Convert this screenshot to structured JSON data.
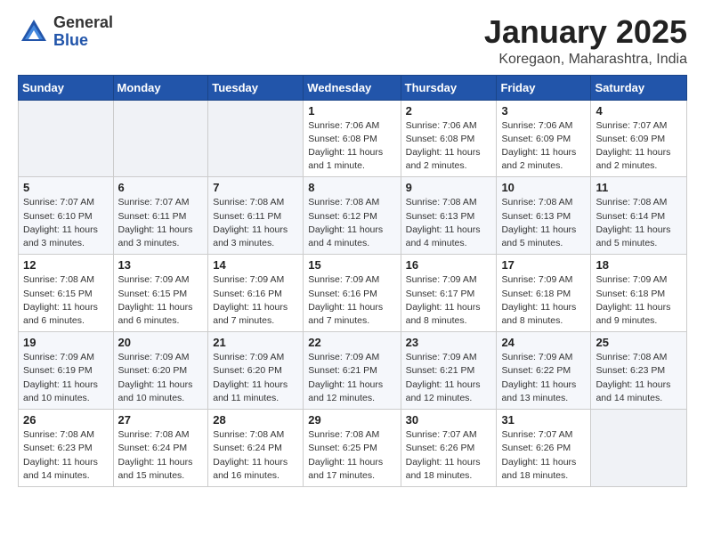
{
  "header": {
    "logo_general": "General",
    "logo_blue": "Blue",
    "month": "January 2025",
    "location": "Koregaon, Maharashtra, India"
  },
  "weekdays": [
    "Sunday",
    "Monday",
    "Tuesday",
    "Wednesday",
    "Thursday",
    "Friday",
    "Saturday"
  ],
  "weeks": [
    [
      {
        "day": "",
        "info": ""
      },
      {
        "day": "",
        "info": ""
      },
      {
        "day": "",
        "info": ""
      },
      {
        "day": "1",
        "info": "Sunrise: 7:06 AM\nSunset: 6:08 PM\nDaylight: 11 hours\nand 1 minute."
      },
      {
        "day": "2",
        "info": "Sunrise: 7:06 AM\nSunset: 6:08 PM\nDaylight: 11 hours\nand 2 minutes."
      },
      {
        "day": "3",
        "info": "Sunrise: 7:06 AM\nSunset: 6:09 PM\nDaylight: 11 hours\nand 2 minutes."
      },
      {
        "day": "4",
        "info": "Sunrise: 7:07 AM\nSunset: 6:09 PM\nDaylight: 11 hours\nand 2 minutes."
      }
    ],
    [
      {
        "day": "5",
        "info": "Sunrise: 7:07 AM\nSunset: 6:10 PM\nDaylight: 11 hours\nand 3 minutes."
      },
      {
        "day": "6",
        "info": "Sunrise: 7:07 AM\nSunset: 6:11 PM\nDaylight: 11 hours\nand 3 minutes."
      },
      {
        "day": "7",
        "info": "Sunrise: 7:08 AM\nSunset: 6:11 PM\nDaylight: 11 hours\nand 3 minutes."
      },
      {
        "day": "8",
        "info": "Sunrise: 7:08 AM\nSunset: 6:12 PM\nDaylight: 11 hours\nand 4 minutes."
      },
      {
        "day": "9",
        "info": "Sunrise: 7:08 AM\nSunset: 6:13 PM\nDaylight: 11 hours\nand 4 minutes."
      },
      {
        "day": "10",
        "info": "Sunrise: 7:08 AM\nSunset: 6:13 PM\nDaylight: 11 hours\nand 5 minutes."
      },
      {
        "day": "11",
        "info": "Sunrise: 7:08 AM\nSunset: 6:14 PM\nDaylight: 11 hours\nand 5 minutes."
      }
    ],
    [
      {
        "day": "12",
        "info": "Sunrise: 7:08 AM\nSunset: 6:15 PM\nDaylight: 11 hours\nand 6 minutes."
      },
      {
        "day": "13",
        "info": "Sunrise: 7:09 AM\nSunset: 6:15 PM\nDaylight: 11 hours\nand 6 minutes."
      },
      {
        "day": "14",
        "info": "Sunrise: 7:09 AM\nSunset: 6:16 PM\nDaylight: 11 hours\nand 7 minutes."
      },
      {
        "day": "15",
        "info": "Sunrise: 7:09 AM\nSunset: 6:16 PM\nDaylight: 11 hours\nand 7 minutes."
      },
      {
        "day": "16",
        "info": "Sunrise: 7:09 AM\nSunset: 6:17 PM\nDaylight: 11 hours\nand 8 minutes."
      },
      {
        "day": "17",
        "info": "Sunrise: 7:09 AM\nSunset: 6:18 PM\nDaylight: 11 hours\nand 8 minutes."
      },
      {
        "day": "18",
        "info": "Sunrise: 7:09 AM\nSunset: 6:18 PM\nDaylight: 11 hours\nand 9 minutes."
      }
    ],
    [
      {
        "day": "19",
        "info": "Sunrise: 7:09 AM\nSunset: 6:19 PM\nDaylight: 11 hours\nand 10 minutes."
      },
      {
        "day": "20",
        "info": "Sunrise: 7:09 AM\nSunset: 6:20 PM\nDaylight: 11 hours\nand 10 minutes."
      },
      {
        "day": "21",
        "info": "Sunrise: 7:09 AM\nSunset: 6:20 PM\nDaylight: 11 hours\nand 11 minutes."
      },
      {
        "day": "22",
        "info": "Sunrise: 7:09 AM\nSunset: 6:21 PM\nDaylight: 11 hours\nand 12 minutes."
      },
      {
        "day": "23",
        "info": "Sunrise: 7:09 AM\nSunset: 6:21 PM\nDaylight: 11 hours\nand 12 minutes."
      },
      {
        "day": "24",
        "info": "Sunrise: 7:09 AM\nSunset: 6:22 PM\nDaylight: 11 hours\nand 13 minutes."
      },
      {
        "day": "25",
        "info": "Sunrise: 7:08 AM\nSunset: 6:23 PM\nDaylight: 11 hours\nand 14 minutes."
      }
    ],
    [
      {
        "day": "26",
        "info": "Sunrise: 7:08 AM\nSunset: 6:23 PM\nDaylight: 11 hours\nand 14 minutes."
      },
      {
        "day": "27",
        "info": "Sunrise: 7:08 AM\nSunset: 6:24 PM\nDaylight: 11 hours\nand 15 minutes."
      },
      {
        "day": "28",
        "info": "Sunrise: 7:08 AM\nSunset: 6:24 PM\nDaylight: 11 hours\nand 16 minutes."
      },
      {
        "day": "29",
        "info": "Sunrise: 7:08 AM\nSunset: 6:25 PM\nDaylight: 11 hours\nand 17 minutes."
      },
      {
        "day": "30",
        "info": "Sunrise: 7:07 AM\nSunset: 6:26 PM\nDaylight: 11 hours\nand 18 minutes."
      },
      {
        "day": "31",
        "info": "Sunrise: 7:07 AM\nSunset: 6:26 PM\nDaylight: 11 hours\nand 18 minutes."
      },
      {
        "day": "",
        "info": ""
      }
    ]
  ]
}
